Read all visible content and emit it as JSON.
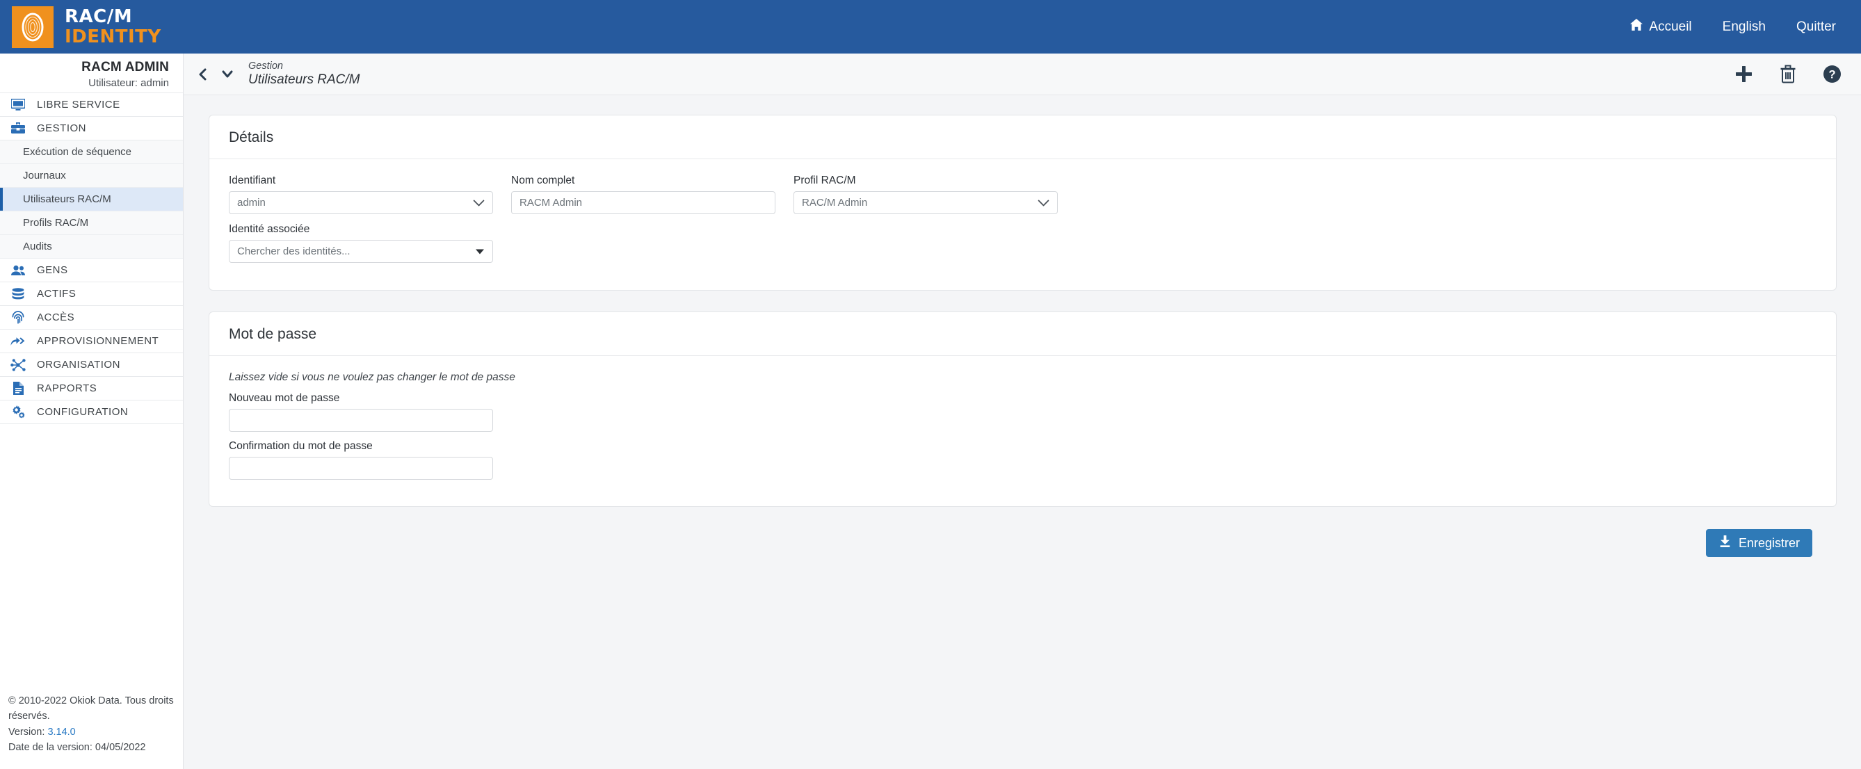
{
  "brand": {
    "line1": "RAC/M",
    "line2": "IDENTITY",
    "logo_icon": "fingerprint-icon",
    "header_color": "#265a9e",
    "accent_color": "#f0911e"
  },
  "topnav": [
    {
      "label": "Accueil",
      "icon": "home-icon"
    },
    {
      "label": "English",
      "icon": ""
    },
    {
      "label": "Quitter",
      "icon": ""
    }
  ],
  "user_panel": {
    "name": "RACM ADMIN",
    "subtitle": "Utilisateur: admin"
  },
  "sidebar": {
    "items": [
      {
        "label": "LIBRE SERVICE",
        "icon": "desktop-icon",
        "type": "top"
      },
      {
        "label": "GESTION",
        "icon": "toolbox-icon",
        "type": "top"
      },
      {
        "label": "Exécution de séquence",
        "icon": "",
        "type": "sub",
        "selected": false
      },
      {
        "label": "Journaux",
        "icon": "",
        "type": "sub",
        "selected": false
      },
      {
        "label": "Utilisateurs RAC/M",
        "icon": "",
        "type": "sub",
        "selected": true
      },
      {
        "label": "Profils RAC/M",
        "icon": "",
        "type": "sub",
        "selected": false
      },
      {
        "label": "Audits",
        "icon": "",
        "type": "sub",
        "selected": false
      },
      {
        "label": "GENS",
        "icon": "people-icon",
        "type": "top"
      },
      {
        "label": "ACTIFS",
        "icon": "database-icon",
        "type": "top"
      },
      {
        "label": "ACCÈS",
        "icon": "fingerprint-icon",
        "type": "top"
      },
      {
        "label": "APPROVISIONNEMENT",
        "icon": "share-arrow-icon",
        "type": "top"
      },
      {
        "label": "ORGANISATION",
        "icon": "network-nodes-icon",
        "type": "top"
      },
      {
        "label": "RAPPORTS",
        "icon": "document-icon",
        "type": "top"
      },
      {
        "label": "CONFIGURATION",
        "icon": "gears-icon",
        "type": "top"
      }
    ]
  },
  "footer": {
    "copyright": "© 2010-2022 Okiok Data. Tous droits réservés.",
    "version_label": "Version:",
    "version_value": "3.14.0",
    "version_date": "Date de la version: 04/05/2022"
  },
  "page_head": {
    "breadcrumb_parent": "Gestion",
    "breadcrumb_current": "Utilisateurs RAC/M",
    "back_icon": "chevron-left-icon",
    "dropdown_icon": "chevron-down-icon",
    "actions": [
      {
        "name": "add",
        "icon": "plus-icon"
      },
      {
        "name": "delete",
        "icon": "trash-icon"
      },
      {
        "name": "help",
        "icon": "question-circle-icon"
      }
    ]
  },
  "details_card": {
    "title": "Détails",
    "fields": {
      "identifiant": {
        "label": "Identifiant",
        "value": "admin",
        "control": "select"
      },
      "nom_complet": {
        "label": "Nom complet",
        "value": "RACM Admin",
        "control": "text"
      },
      "profil": {
        "label": "Profil RAC/M",
        "value": "RAC/M Admin",
        "control": "select"
      },
      "identite_associee": {
        "label": "Identité associée",
        "value": "",
        "placeholder": "Chercher des identités...",
        "control": "search-select"
      }
    }
  },
  "password_card": {
    "title": "Mot de passe",
    "hint": "Laissez vide si vous ne voulez pas changer le mot de passe",
    "new_password": {
      "label": "Nouveau mot de passe",
      "value": ""
    },
    "confirm_password": {
      "label": "Confirmation du mot de passe",
      "value": ""
    }
  },
  "save": {
    "label": "Enregistrer",
    "icon": "download-save-icon",
    "color": "#2f7ab7"
  }
}
